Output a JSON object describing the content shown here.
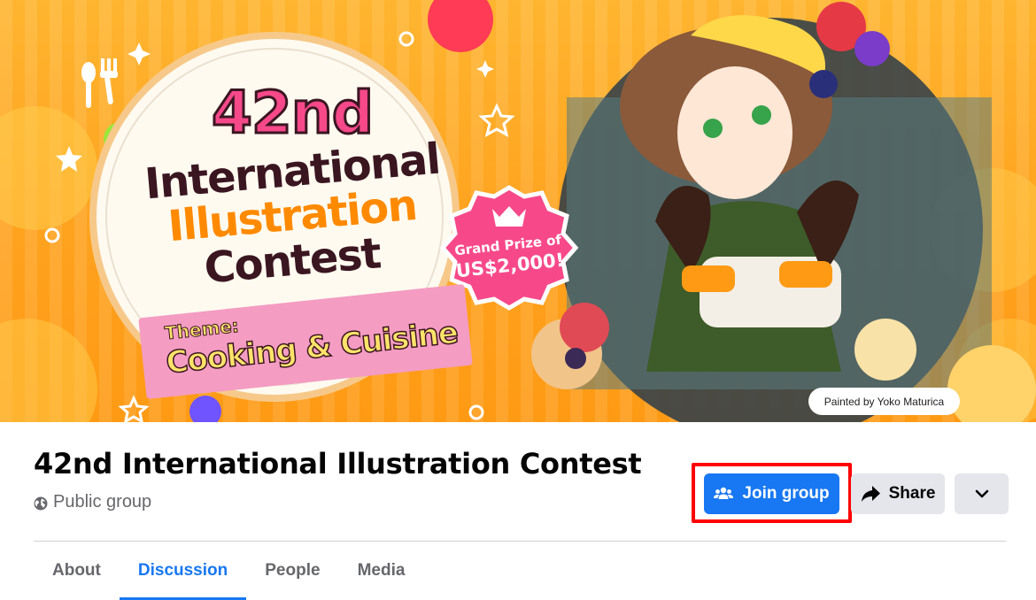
{
  "cover": {
    "headline_number": "42nd",
    "headline_line1": "International",
    "headline_line2": "Illustration",
    "headline_line3": "Contest",
    "theme_label": "Theme:",
    "theme_value": "Cooking & Cuisine",
    "prize_line1": "Grand Prize of",
    "prize_line2": "US$2,000!",
    "credit": "Painted by Yoko Maturica",
    "colors": {
      "background": "#ffa21e",
      "headline": "#3a1621",
      "accent_orange": "#ff8a00",
      "pink": "#f7498a",
      "ribbon": "#f49cc2"
    }
  },
  "group": {
    "title": "42nd International Illustration Contest",
    "privacy": "Public group"
  },
  "actions": {
    "join_label": "Join group",
    "share_label": "Share",
    "more_icon": "chevron-down-icon",
    "join_color": "#1877f2",
    "highlight_color": "#ff0000"
  },
  "tabs": [
    {
      "label": "About",
      "active": false
    },
    {
      "label": "Discussion",
      "active": true
    },
    {
      "label": "People",
      "active": false
    },
    {
      "label": "Media",
      "active": false
    }
  ]
}
